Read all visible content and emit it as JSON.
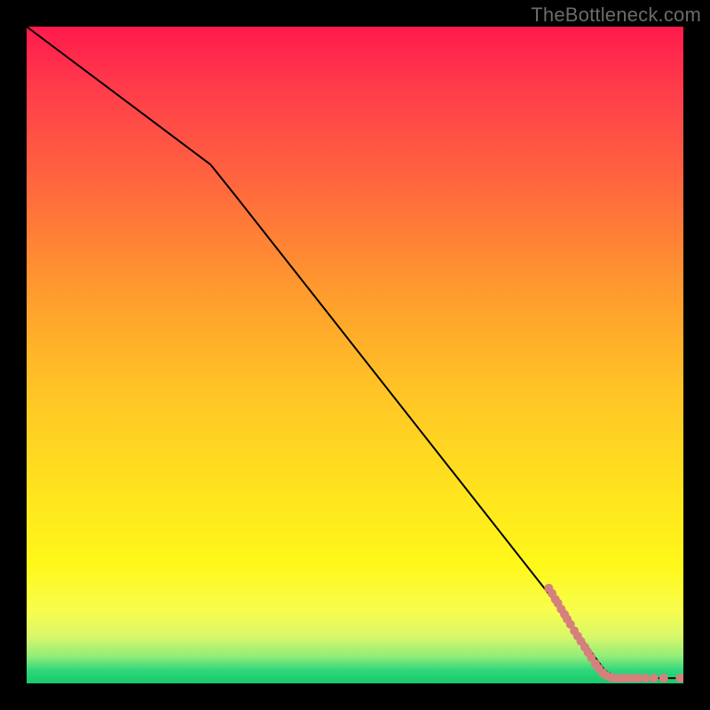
{
  "watermark": "TheBottleneck.com",
  "chart_data": {
    "type": "line",
    "title": "",
    "xlabel": "",
    "ylabel": "",
    "xlim": [
      0,
      100
    ],
    "ylim": [
      0,
      100
    ],
    "line_series": {
      "name": "curve",
      "points": [
        {
          "x": 0,
          "y": 100
        },
        {
          "x": 28,
          "y": 79
        },
        {
          "x": 32,
          "y": 74
        },
        {
          "x": 80,
          "y": 13
        },
        {
          "x": 88,
          "y": 2
        },
        {
          "x": 90,
          "y": 0.8
        },
        {
          "x": 100,
          "y": 0.8
        }
      ]
    },
    "scatter_series": {
      "name": "data-points",
      "color": "#d6807e",
      "points": [
        {
          "x": 79.5,
          "y": 14.5
        },
        {
          "x": 80.0,
          "y": 13.7
        },
        {
          "x": 80.5,
          "y": 12.8
        },
        {
          "x": 80.9,
          "y": 12.2
        },
        {
          "x": 81.4,
          "y": 11.3
        },
        {
          "x": 81.9,
          "y": 10.5
        },
        {
          "x": 82.3,
          "y": 9.8
        },
        {
          "x": 82.8,
          "y": 9.0
        },
        {
          "x": 83.4,
          "y": 8.0
        },
        {
          "x": 83.9,
          "y": 7.2
        },
        {
          "x": 84.4,
          "y": 6.4
        },
        {
          "x": 85.0,
          "y": 5.5
        },
        {
          "x": 85.5,
          "y": 4.7
        },
        {
          "x": 86.0,
          "y": 3.9
        },
        {
          "x": 86.6,
          "y": 3.0
        },
        {
          "x": 87.1,
          "y": 2.3
        },
        {
          "x": 87.7,
          "y": 1.6
        },
        {
          "x": 88.3,
          "y": 1.2
        },
        {
          "x": 89.0,
          "y": 0.9
        },
        {
          "x": 89.7,
          "y": 0.8
        },
        {
          "x": 90.5,
          "y": 0.8
        },
        {
          "x": 91.3,
          "y": 0.8
        },
        {
          "x": 92.2,
          "y": 0.8
        },
        {
          "x": 93.1,
          "y": 0.8
        },
        {
          "x": 94.2,
          "y": 0.8
        },
        {
          "x": 95.5,
          "y": 0.8
        },
        {
          "x": 97.0,
          "y": 0.8
        },
        {
          "x": 99.5,
          "y": 0.8
        }
      ]
    }
  }
}
